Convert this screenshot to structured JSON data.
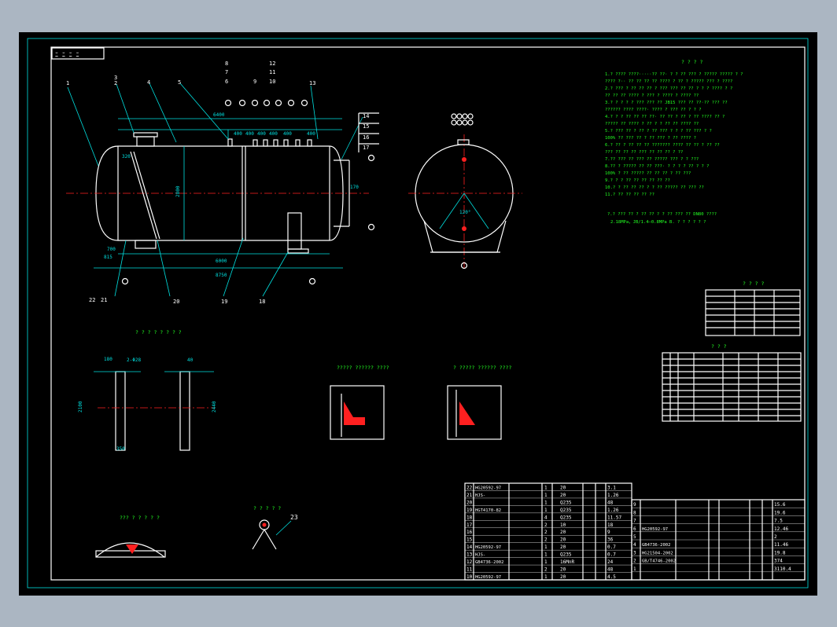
{
  "drawing": {
    "title_block_row_nums": [
      "22",
      "21",
      "20",
      "19",
      "18",
      "17",
      "16",
      "15",
      "14",
      "13",
      "12",
      "11",
      "10"
    ],
    "title_block_row_nums_right": [
      "9",
      "8",
      "7",
      "6",
      "5",
      "4",
      "3",
      "2",
      "1"
    ],
    "callouts": [
      "1",
      "2",
      "3",
      "4",
      "5",
      "6",
      "7",
      "8",
      "9",
      "10",
      "11",
      "12",
      "13",
      "14",
      "15",
      "16",
      "17",
      "18",
      "19",
      "20",
      "21",
      "22",
      "23"
    ],
    "dims": {
      "length_total": "8750",
      "length_shell": "6000",
      "overall_top": "6400",
      "dia": "2800",
      "side_a": "700",
      "side_b": "815",
      "nozzles": [
        "400",
        "400",
        "400",
        "400",
        "400",
        "400"
      ],
      "short_c": "320",
      "short_d": "170",
      "angle": "120°"
    },
    "tech_req_lines": [
      "2.18MPa，JB/1.4—0.8MPa  B.  ? ? ? ? ? ?"
    ],
    "saddle_dims": {
      "top": "180",
      "gap": "2-Φ28",
      "h1": "2100",
      "h2": "2440",
      "base": "350",
      "top2": "40"
    },
    "weld_label": "23",
    "table_row_codes_left": [
      "HG20592-97",
      "HJS-",
      "",
      "HGT4170-82",
      "",
      "",
      "",
      "",
      "HG20592-97",
      "HJS-",
      "GB4736-2002",
      "",
      "HG20592-97"
    ],
    "table_row_codes_right": [
      "",
      "",
      "",
      "HG20592-97",
      "",
      "GB4736-2002",
      "HG21504-2002",
      "GB/T4746-2002",
      ""
    ],
    "table_qty_left": [
      "1",
      "1",
      "1",
      "1",
      "4",
      "2",
      "2",
      "2",
      "1",
      "1",
      "1",
      "2",
      "1"
    ],
    "table_mat_left": [
      "20",
      "20",
      "Q235",
      "Q235",
      "Q235",
      "10",
      "20",
      "20",
      "20",
      "Q235",
      "16MnR",
      "20",
      "20"
    ],
    "table_wt_left": [
      "3.1",
      "1.26",
      "48",
      "1.26",
      "11.57",
      "18",
      "9",
      "36",
      "0.7",
      "0.7",
      "24",
      "48",
      "4.5"
    ],
    "table_wt_right": [
      "15.6",
      "19.6",
      "7.5",
      "12.46",
      "2",
      "11.46",
      "19.8",
      "374",
      "3110.4"
    ],
    "nozzle_table_codes": [
      "a",
      "b",
      "c",
      "d",
      "e",
      "f",
      "g",
      "h",
      "i",
      "j",
      "k"
    ],
    "nozzle_dn": [
      "200",
      "150",
      "150",
      "150",
      "150",
      "150",
      "150",
      "150",
      "150",
      "150",
      "150"
    ]
  }
}
